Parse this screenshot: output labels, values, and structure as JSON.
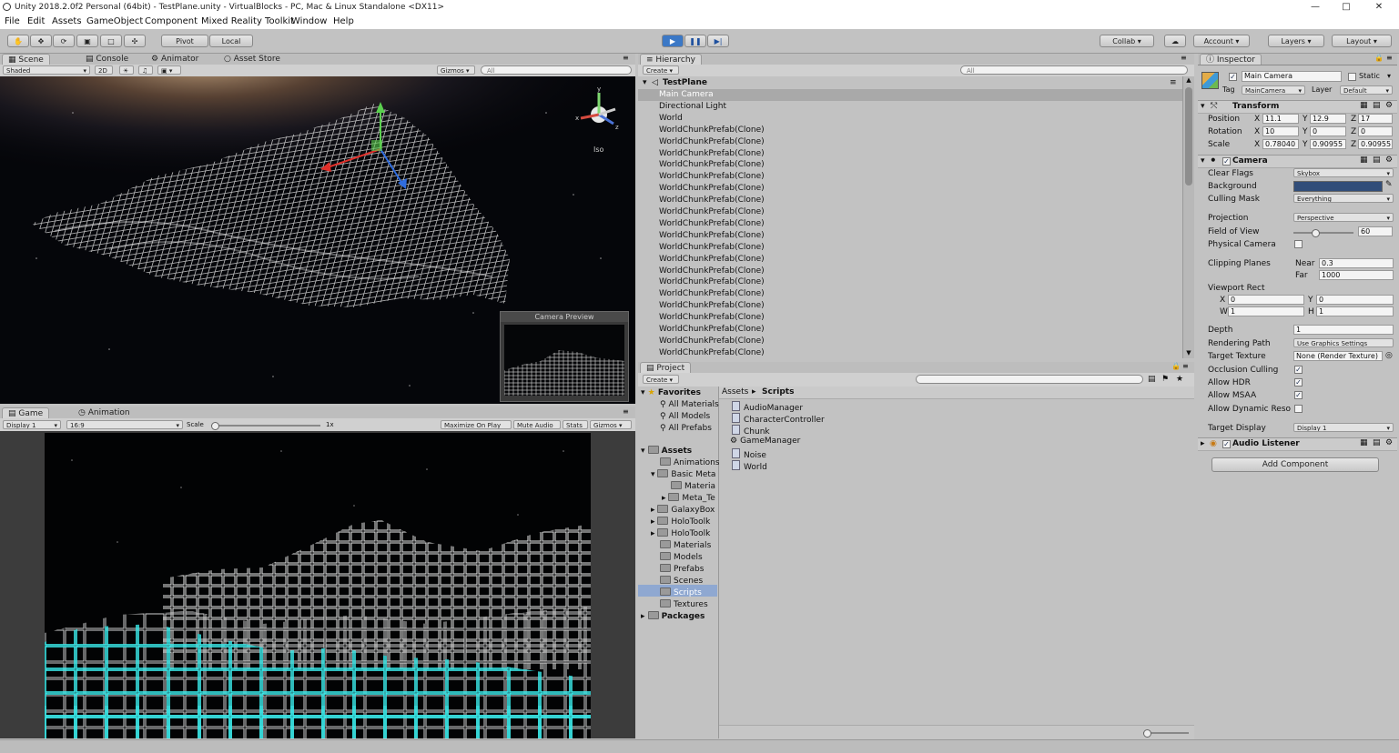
{
  "window": {
    "title": "Unity 2018.2.0f2 Personal (64bit) - TestPlane.unity - VirtualBlocks - PC, Mac & Linux Standalone <DX11>",
    "minimize_icon": "minimize-icon",
    "maximize_icon": "maximize-icon",
    "close_icon": "close-icon"
  },
  "menu": [
    "File",
    "Edit",
    "Assets",
    "GameObject",
    "Component",
    "Mixed Reality Toolkit",
    "Window",
    "Help"
  ],
  "toolbar": {
    "pivot": "Pivot",
    "local": "Local",
    "collab": "Collab",
    "account": "Account",
    "layers": "Layers",
    "layout": "Layout"
  },
  "scene": {
    "tabs": [
      "Scene",
      "Console",
      "Animator",
      "Asset Store"
    ],
    "shading": "Shaded",
    "mode_2d": "2D",
    "gizmos": "Gizmos",
    "search": "All",
    "iso_label": "Iso",
    "camera_preview": "Camera Preview"
  },
  "game": {
    "tabs": [
      "Game",
      "Animation"
    ],
    "display": "Display 1",
    "aspect": "16:9",
    "scale_label": "Scale",
    "scale_value": "1x",
    "maximize": "Maximize On Play",
    "mute": "Mute Audio",
    "stats": "Stats",
    "gizmos": "Gizmos"
  },
  "hierarchy": {
    "tab": "Hierarchy",
    "create": "Create",
    "search": "All",
    "scene": "TestPlane",
    "items": [
      "Main Camera",
      "Directional Light",
      "World",
      "WorldChunkPrefab(Clone)",
      "WorldChunkPrefab(Clone)",
      "WorldChunkPrefab(Clone)",
      "WorldChunkPrefab(Clone)",
      "WorldChunkPrefab(Clone)",
      "WorldChunkPrefab(Clone)",
      "WorldChunkPrefab(Clone)",
      "WorldChunkPrefab(Clone)",
      "WorldChunkPrefab(Clone)",
      "WorldChunkPrefab(Clone)",
      "WorldChunkPrefab(Clone)",
      "WorldChunkPrefab(Clone)",
      "WorldChunkPrefab(Clone)",
      "WorldChunkPrefab(Clone)",
      "WorldChunkPrefab(Clone)",
      "WorldChunkPrefab(Clone)",
      "WorldChunkPrefab(Clone)",
      "WorldChunkPrefab(Clone)",
      "WorldChunkPrefab(Clone)",
      "WorldChunkPrefab(Clone)",
      "WorldChunkPrefab(Clone)",
      "WorldChunkPrefab(Clone)"
    ]
  },
  "project": {
    "tab": "Project",
    "create": "Create",
    "favorites": "Favorites",
    "fav_items": [
      "All Materials",
      "All Models",
      "All Prefabs"
    ],
    "assets_root": "Assets",
    "assets_tree": [
      "Animations",
      "Basic Meta",
      "Materia",
      "Meta_Te",
      "GalaxyBox",
      "HoloToolk",
      "HoloToolk",
      "Materials",
      "Models",
      "Prefabs",
      "Scenes",
      "Scripts",
      "Textures"
    ],
    "packages": "Packages",
    "breadcrumb_root": "Assets",
    "breadcrumb_sep": "▸",
    "breadcrumb_leaf": "Scripts",
    "files": [
      "AudioManager",
      "CharacterController",
      "Chunk",
      "GameManager",
      "Noise",
      "World"
    ]
  },
  "inspector": {
    "tab": "Inspector",
    "name": "Main Camera",
    "static_label": "Static",
    "tag_label": "Tag",
    "tag": "MainCamera",
    "layer_label": "Layer",
    "layer": "Default",
    "transform": {
      "title": "Transform",
      "position_label": "Position",
      "rotation_label": "Rotation",
      "scale_label": "Scale",
      "position": {
        "x": "11.1",
        "y": "12.9",
        "z": "17"
      },
      "rotation": {
        "x": "10",
        "y": "0",
        "z": "0"
      },
      "scale": {
        "x": "0.78040",
        "y": "0.90955",
        "z": "0.90955"
      }
    },
    "camera": {
      "title": "Camera",
      "clear_flags_label": "Clear Flags",
      "clear_flags": "Skybox",
      "background_label": "Background",
      "culling_label": "Culling Mask",
      "culling": "Everything",
      "projection_label": "Projection",
      "projection": "Perspective",
      "fov_label": "Field of View",
      "fov": "60",
      "physical_label": "Physical Camera",
      "clipping_label": "Clipping Planes",
      "near_label": "Near",
      "near": "0.3",
      "far_label": "Far",
      "far": "1000",
      "viewport_label": "Viewport Rect",
      "vx_label": "X",
      "vx": "0",
      "vy_label": "Y",
      "vy": "0",
      "vw_label": "W",
      "vw": "1",
      "vh_label": "H",
      "vh": "1",
      "depth_label": "Depth",
      "depth": "1",
      "rendering_label": "Rendering Path",
      "rendering": "Use Graphics Settings",
      "target_tex_label": "Target Texture",
      "target_tex": "None (Render Texture)",
      "occlusion_label": "Occlusion Culling",
      "hdr_label": "Allow HDR",
      "msaa_label": "Allow MSAA",
      "dynres_label": "Allow Dynamic Reso",
      "target_disp_label": "Target Display",
      "target_disp": "Display 1"
    },
    "audio": {
      "title": "Audio Listener"
    },
    "add_component": "Add Component"
  },
  "colors": {
    "accent": "#3b78c6",
    "background_swatch": "#314d79",
    "selection": "#8fa8d1",
    "wire_white": "#dcdcdc",
    "wire_cyan": "#38e8e8"
  }
}
